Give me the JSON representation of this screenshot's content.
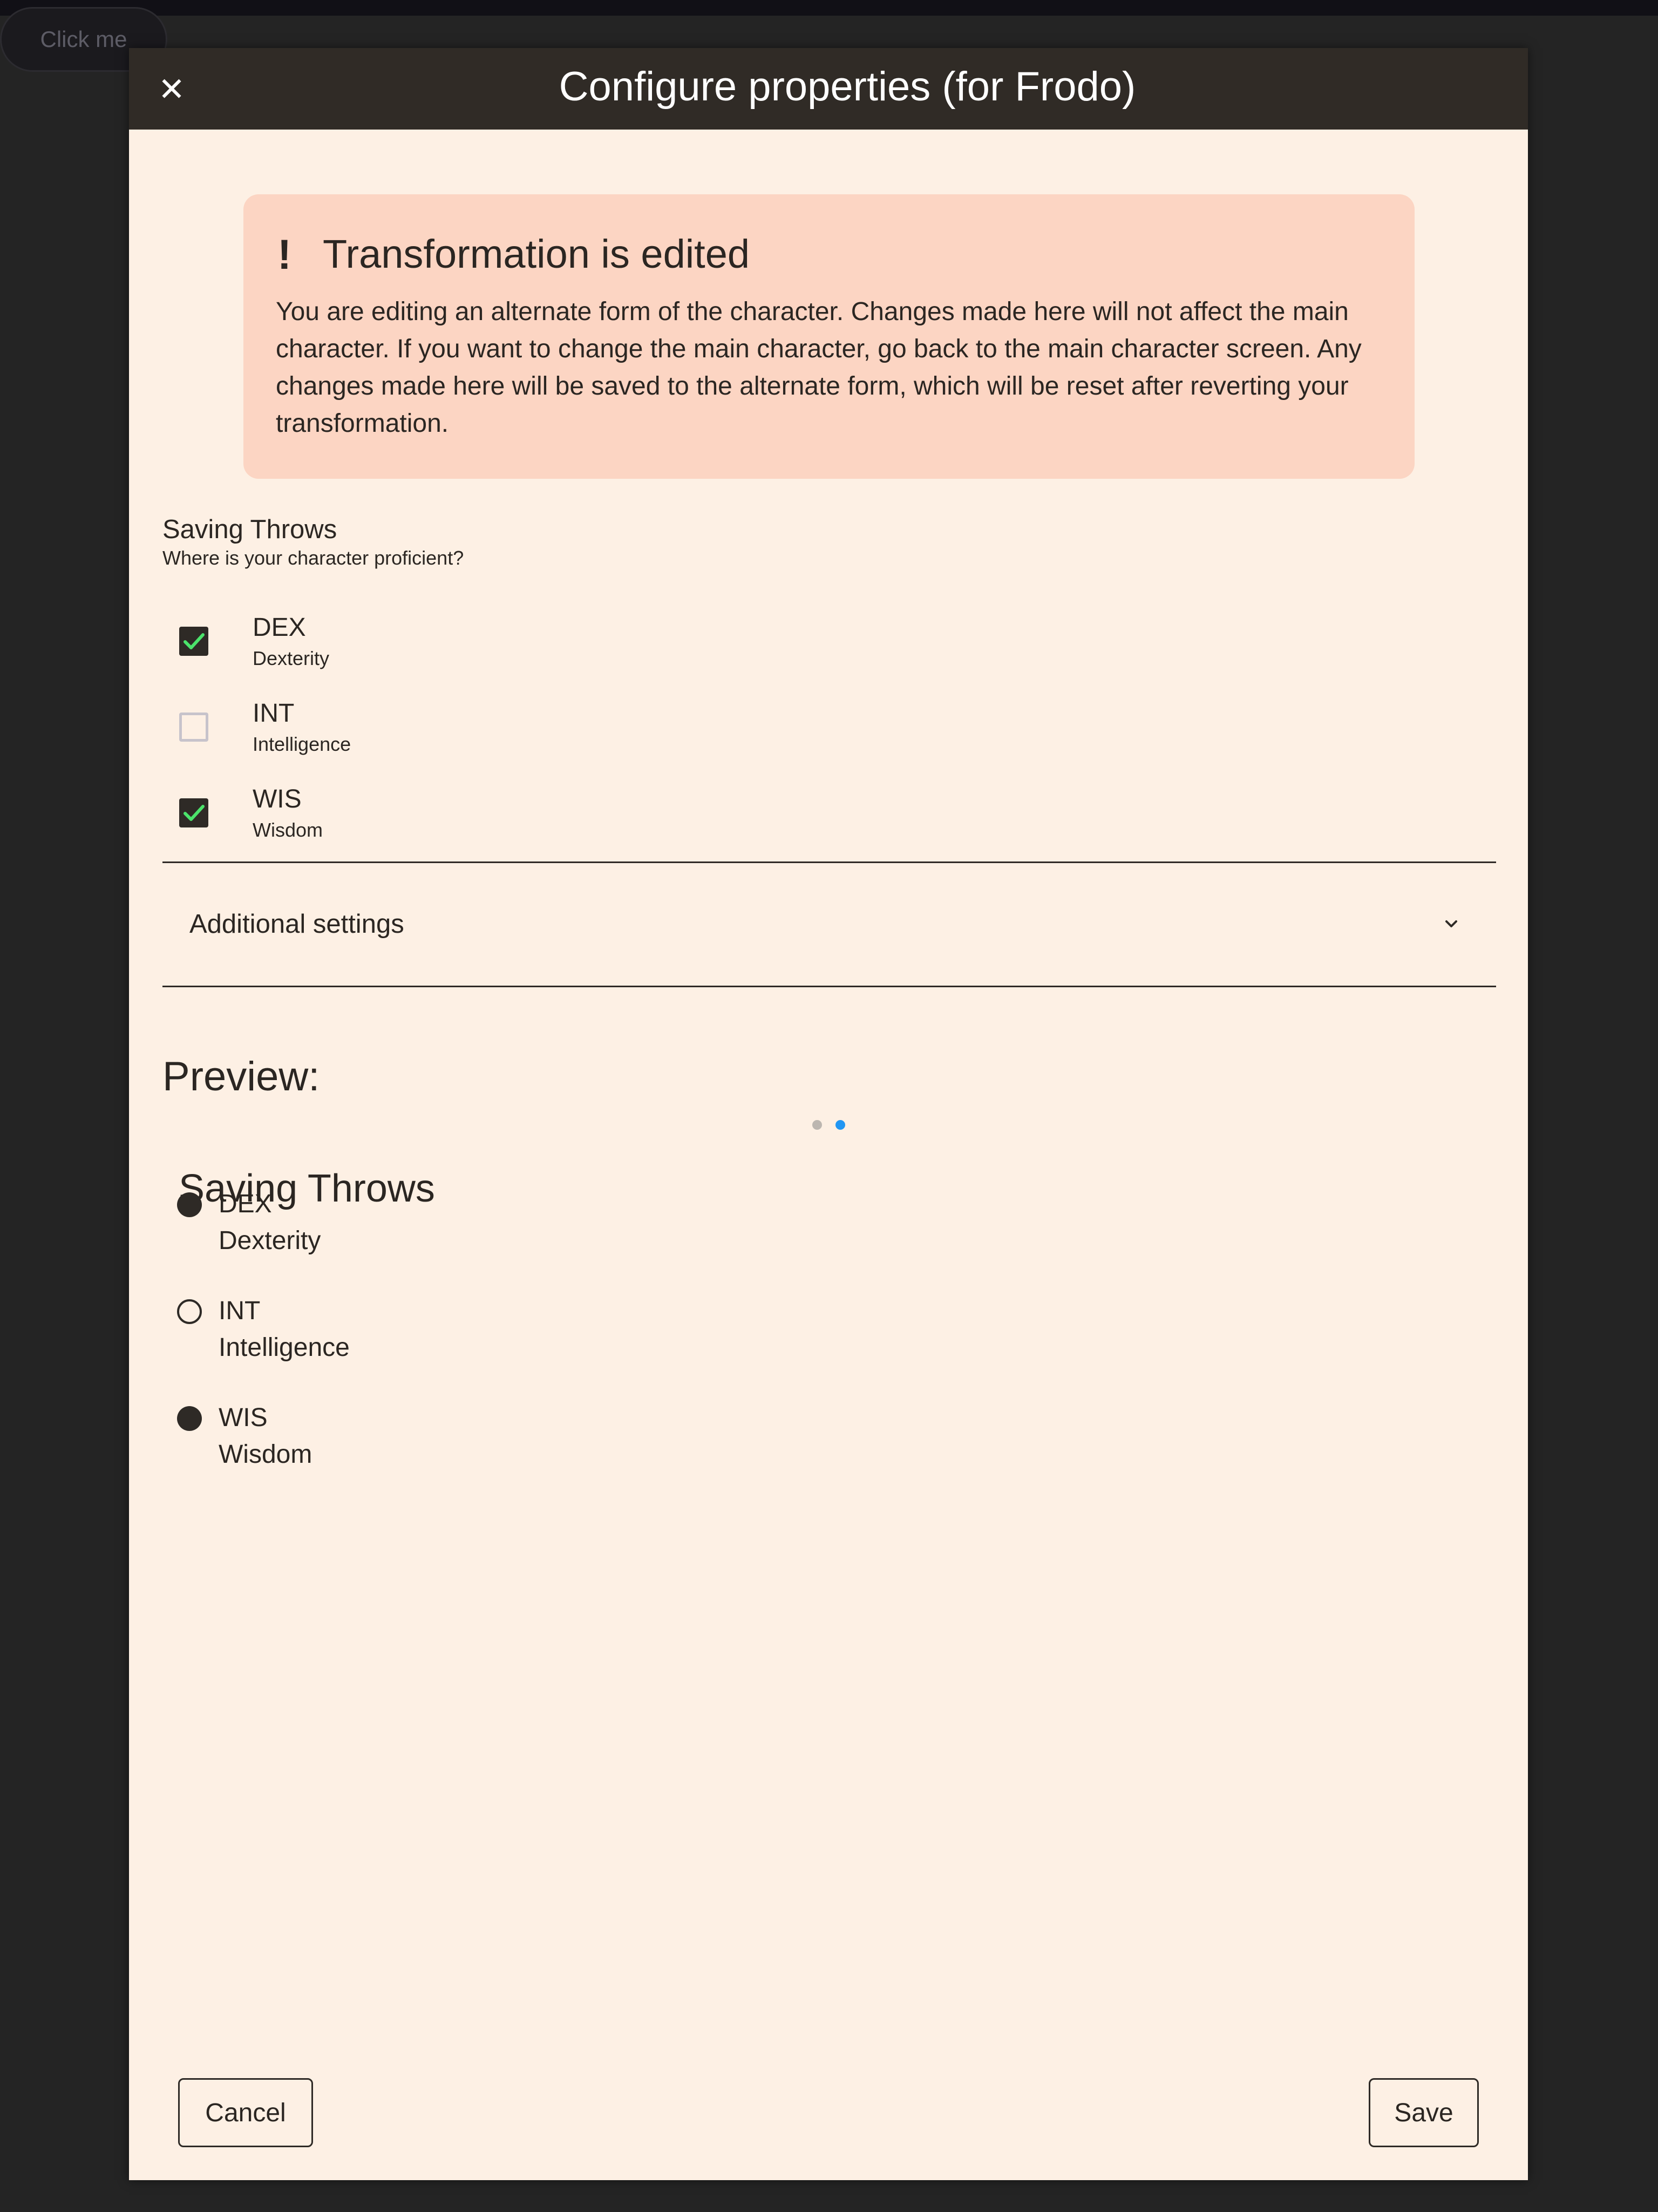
{
  "background": {
    "button_label": "Click me"
  },
  "dialog": {
    "title": "Configure properties (for Frodo)",
    "close_icon": "close-icon"
  },
  "alert": {
    "icon": "!",
    "title": "Transformation is edited",
    "body": "You are editing an alternate form of the character. Changes made here will not affect the main character. If you want to change the main character, go back to the main character screen. Any changes made here will be saved to the alternate form, which will be reset after reverting your transformation."
  },
  "saving_throws": {
    "title": "Saving Throws",
    "subtitle": "Where is your character proficient?",
    "options": [
      {
        "abbr": "DEX",
        "name": "Dexterity",
        "checked": true
      },
      {
        "abbr": "INT",
        "name": "Intelligence",
        "checked": false
      },
      {
        "abbr": "WIS",
        "name": "Wisdom",
        "checked": true
      }
    ]
  },
  "accordion": {
    "label": "Additional settings"
  },
  "preview": {
    "label": "Preview:",
    "pager": {
      "pages": 2,
      "active": 2
    },
    "title": "Saving Throws",
    "items": [
      {
        "abbr": "DEX",
        "name": "Dexterity",
        "proficient": true
      },
      {
        "abbr": "INT",
        "name": "Intelligence",
        "proficient": false
      },
      {
        "abbr": "WIS",
        "name": "Wisdom",
        "proficient": true
      }
    ]
  },
  "footer": {
    "cancel_label": "Cancel",
    "save_label": "Save"
  },
  "colors": {
    "dialog_bg": "#fdf0e4",
    "header_bg": "#302b26",
    "alert_bg": "#fcd5c3",
    "check_green": "#4be36b",
    "pager_active": "#2196f3",
    "pager_inactive": "#bcb6b0"
  }
}
